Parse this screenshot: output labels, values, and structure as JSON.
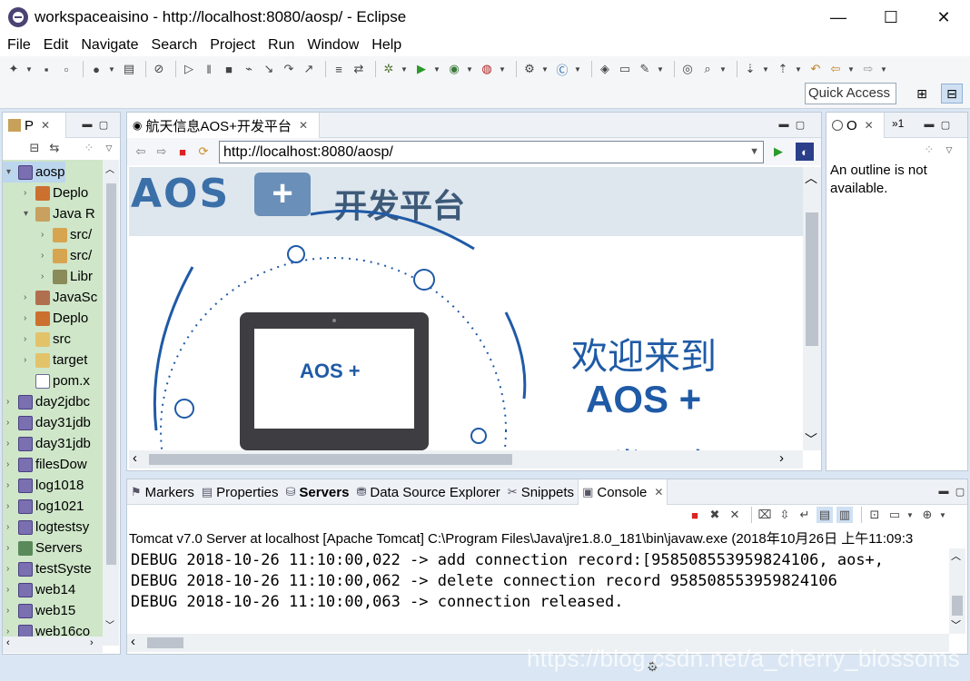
{
  "window": {
    "title": "workspaceaisino - http://localhost:8080/aosp/ - Eclipse",
    "minimize": "—",
    "maximize": "☐",
    "close": "✕"
  },
  "menubar": {
    "items": [
      "File",
      "Edit",
      "Navigate",
      "Search",
      "Project",
      "Run",
      "Window",
      "Help"
    ]
  },
  "toolbar": {
    "quick_access_placeholder": "Quick Access"
  },
  "project_explorer": {
    "tab_label": "P",
    "tree": [
      {
        "label": "aosp",
        "indent": 0,
        "arrow": "▾",
        "icon": "proj",
        "selected": true
      },
      {
        "label": "Deplo",
        "indent": 1,
        "arrow": "›",
        "icon": "dep"
      },
      {
        "label": "Java R",
        "indent": 1,
        "arrow": "▾",
        "icon": "jar"
      },
      {
        "label": "src/",
        "indent": 2,
        "arrow": "›",
        "icon": "pkg"
      },
      {
        "label": "src/",
        "indent": 2,
        "arrow": "›",
        "icon": "pkg"
      },
      {
        "label": "Libr",
        "indent": 2,
        "arrow": "›",
        "icon": "lib"
      },
      {
        "label": "JavaSc",
        "indent": 1,
        "arrow": "›",
        "icon": "js"
      },
      {
        "label": "Deplo",
        "indent": 1,
        "arrow": "›",
        "icon": "dep"
      },
      {
        "label": "src",
        "indent": 1,
        "arrow": "›",
        "icon": "folder"
      },
      {
        "label": "target",
        "indent": 1,
        "arrow": "›",
        "icon": "folder"
      },
      {
        "label": "pom.x",
        "indent": 1,
        "arrow": "",
        "icon": "xml"
      },
      {
        "label": "day2jdbc",
        "indent": 0,
        "arrow": "›",
        "icon": "proj"
      },
      {
        "label": "day31jdb",
        "indent": 0,
        "arrow": "›",
        "icon": "proj"
      },
      {
        "label": "day31jdb",
        "indent": 0,
        "arrow": "›",
        "icon": "proj"
      },
      {
        "label": "filesDow",
        "indent": 0,
        "arrow": "›",
        "icon": "proj"
      },
      {
        "label": "log1018",
        "indent": 0,
        "arrow": "›",
        "icon": "proj"
      },
      {
        "label": "log1021",
        "indent": 0,
        "arrow": "›",
        "icon": "proj"
      },
      {
        "label": "logtestsy",
        "indent": 0,
        "arrow": "›",
        "icon": "proj"
      },
      {
        "label": "Servers",
        "indent": 0,
        "arrow": "›",
        "icon": "srv"
      },
      {
        "label": "testSyste",
        "indent": 0,
        "arrow": "›",
        "icon": "proj"
      },
      {
        "label": "web14",
        "indent": 0,
        "arrow": "›",
        "icon": "proj"
      },
      {
        "label": "web15",
        "indent": 0,
        "arrow": "›",
        "icon": "proj"
      },
      {
        "label": "web16co",
        "indent": 0,
        "arrow": "›",
        "icon": "proj"
      }
    ]
  },
  "browser": {
    "tab_label": "航天信息AOS+开发平台",
    "url": "http://localhost:8080/aosp/",
    "page": {
      "logo_text": "AOS",
      "logo_plus": "+",
      "logo_suffix": "开发平台",
      "screen_text": "AOS +",
      "welcome_line1": "欢迎来到",
      "welcome_line2": "AOS +",
      "welcome_line3": "开发平台",
      "brand_color": "#1f5aa6"
    }
  },
  "outline": {
    "tab_label": "O",
    "overflow_label": "»1",
    "message": "An outline is not available."
  },
  "console": {
    "tabs": [
      {
        "label": "Markers",
        "active": false
      },
      {
        "label": "Properties",
        "active": false
      },
      {
        "label": "Servers",
        "active": false,
        "bold": true
      },
      {
        "label": "Data Source Explorer",
        "active": false
      },
      {
        "label": "Snippets",
        "active": false
      },
      {
        "label": "Console",
        "active": true
      }
    ],
    "info": "Tomcat v7.0 Server at localhost [Apache Tomcat] C:\\Program Files\\Java\\jre1.8.0_181\\bin\\javaw.exe (2018年10月26日 上午11:09:3",
    "lines": [
      "DEBUG 2018-10-26 11:10:00,022 -> add connection record:[958508553959824106, aos+,",
      "DEBUG 2018-10-26 11:10:00,062 -> delete connection record 958508553959824106",
      "DEBUG 2018-10-26 11:10:00,063 -> connection released."
    ]
  },
  "watermark": "https://blog.csdn.net/a_cherry_blossoms"
}
